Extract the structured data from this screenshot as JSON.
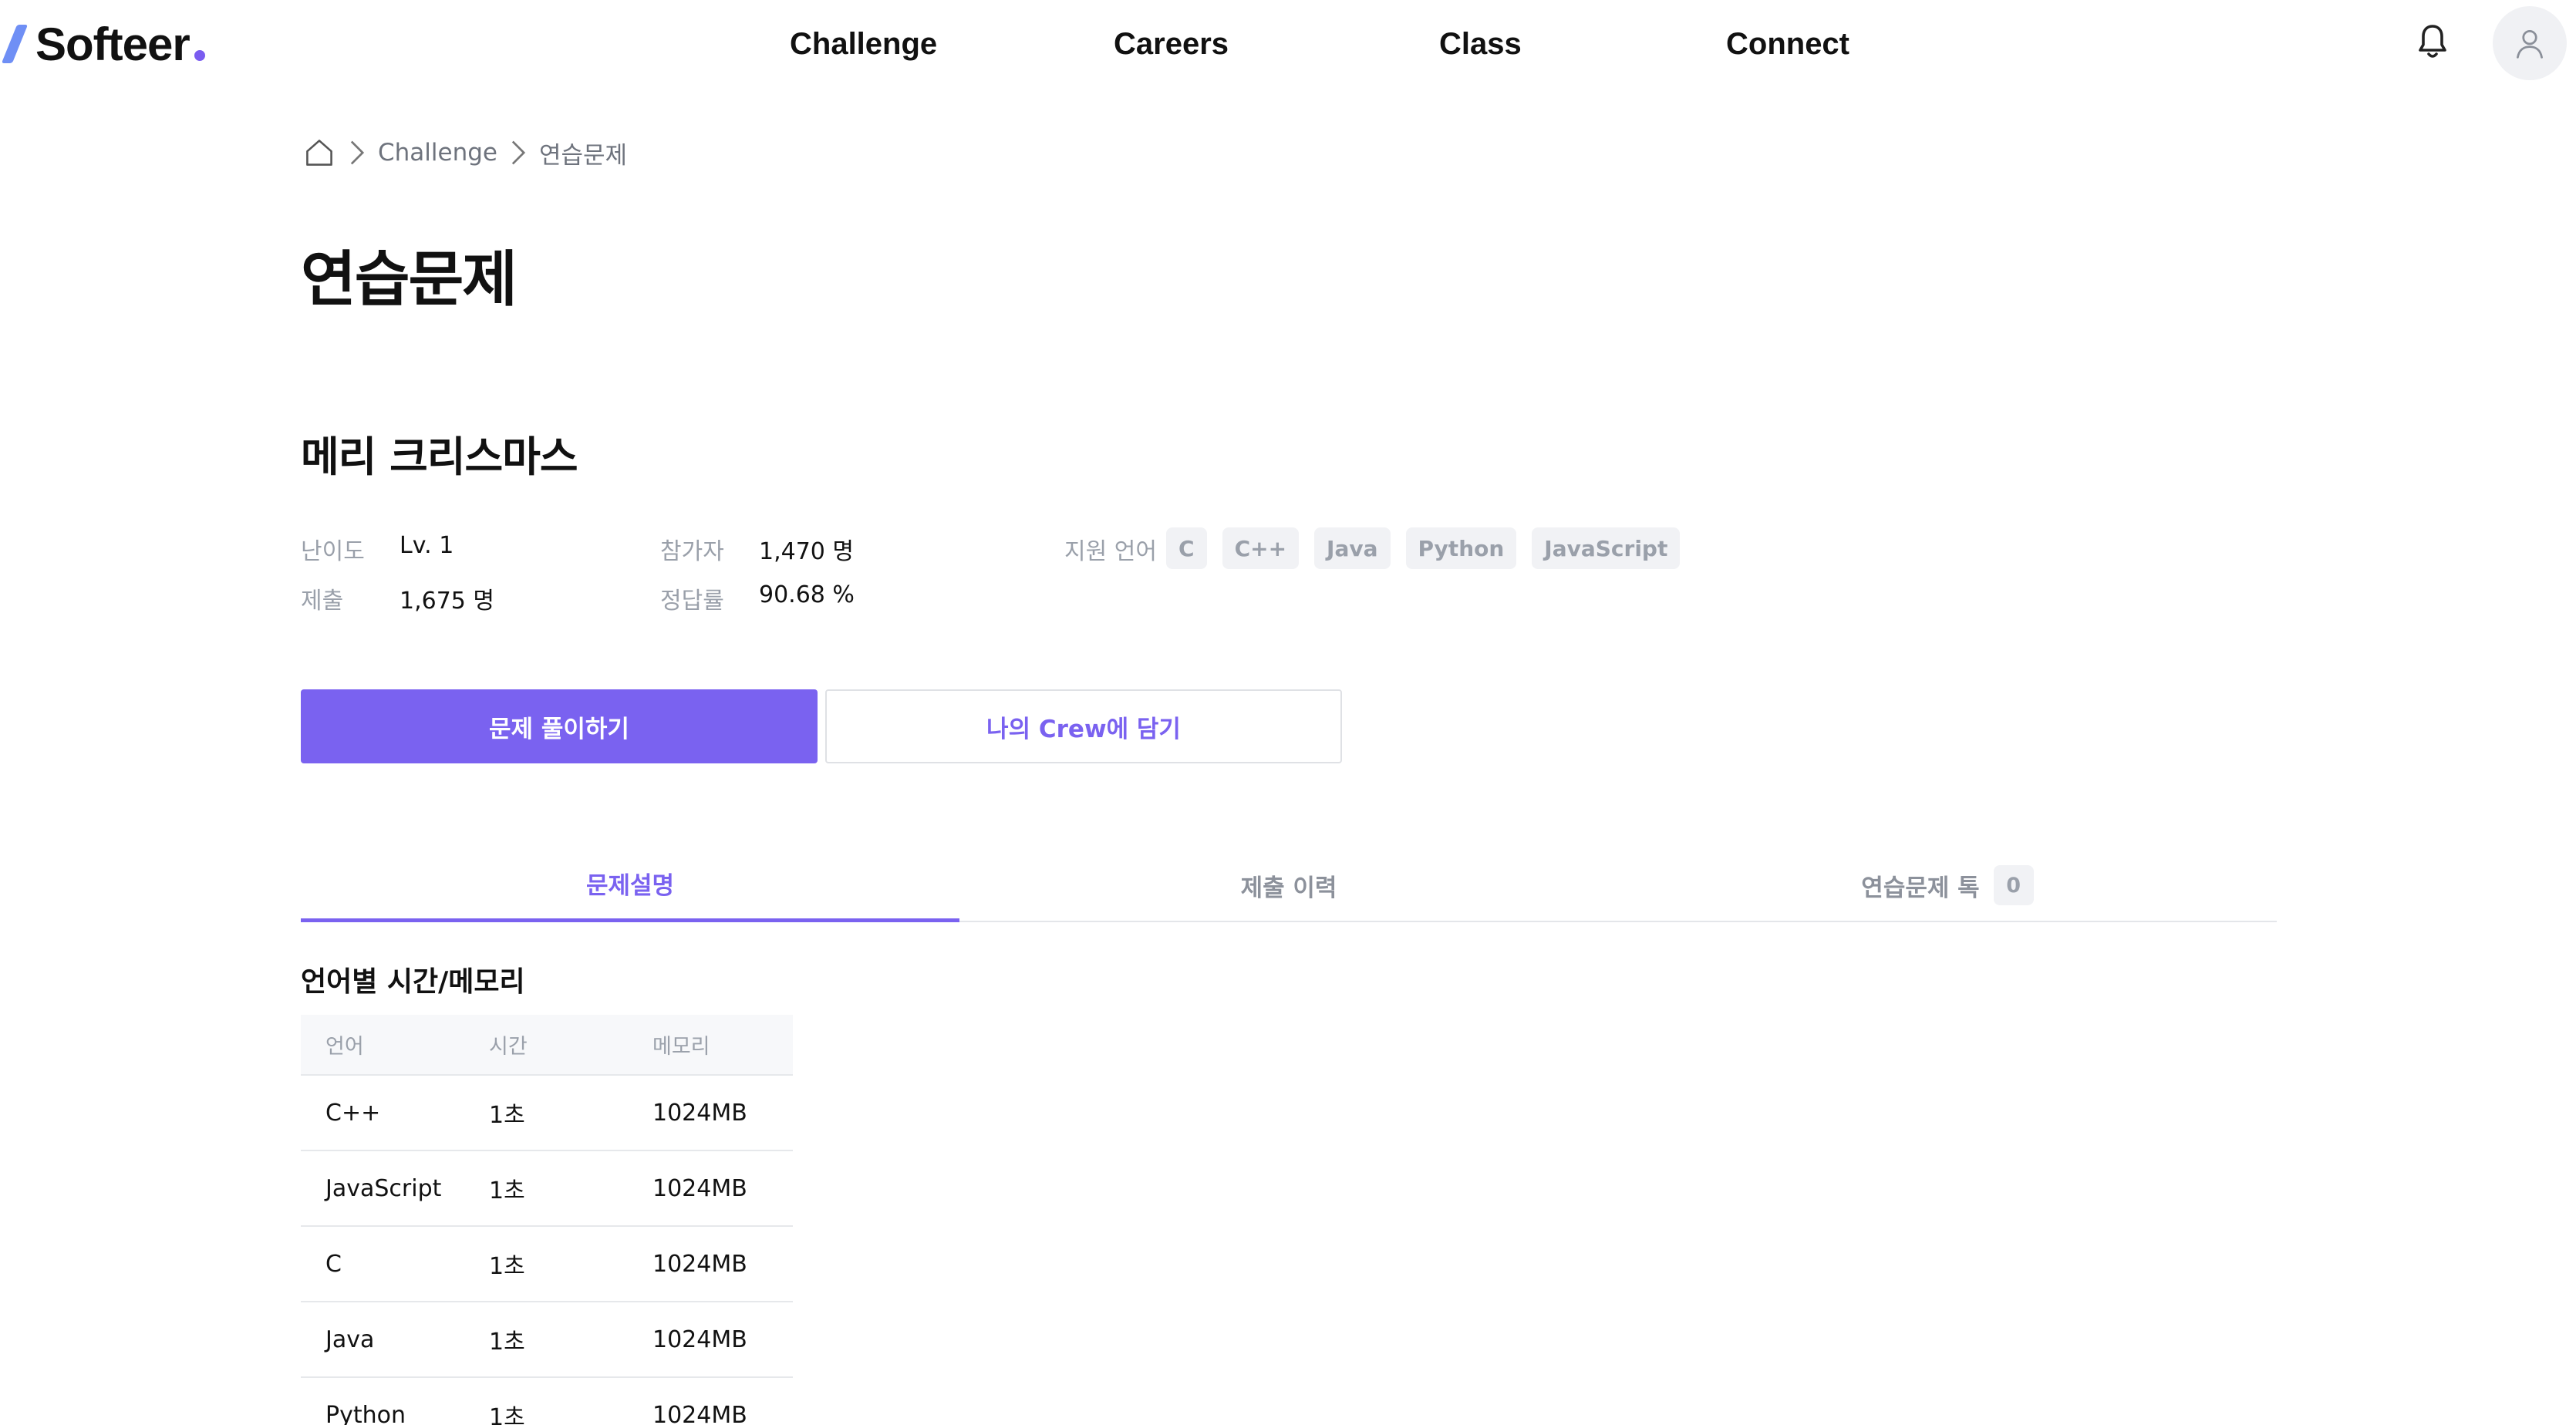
{
  "header": {
    "logo_text": "Softeer",
    "nav": [
      "Challenge",
      "Careers",
      "Class",
      "Connect"
    ],
    "icons": [
      "bell-icon",
      "user-icon"
    ]
  },
  "breadcrumb": {
    "items": [
      "Challenge",
      "연습문제"
    ]
  },
  "page_title": "연습문제",
  "problem": {
    "title": "메리 크리스마스",
    "difficulty_label": "난이도",
    "difficulty_value": "Lv. 1",
    "participants_label": "참가자",
    "participants_value": "1,470 명",
    "submissions_label": "제출",
    "submissions_value": "1,675 명",
    "accuracy_label": "정답률",
    "accuracy_value": "90.68 %",
    "languages_label": "지원 언어",
    "languages": [
      "C",
      "C++",
      "Java",
      "Python",
      "JavaScript"
    ]
  },
  "buttons": {
    "solve": "문제 풀이하기",
    "add_crew": "나의 Crew에 담기"
  },
  "tabs": {
    "description": "문제설명",
    "history": "제출 이력",
    "talk": "연습문제 톡",
    "talk_count": "0"
  },
  "limits": {
    "title": "언어별 시간/메모리",
    "headers": [
      "언어",
      "시간",
      "메모리"
    ],
    "rows": [
      [
        "C++",
        "1초",
        "1024MB"
      ],
      [
        "JavaScript",
        "1초",
        "1024MB"
      ],
      [
        "C",
        "1초",
        "1024MB"
      ],
      [
        "Java",
        "1초",
        "1024MB"
      ],
      [
        "Python",
        "1초",
        "1024MB"
      ]
    ]
  },
  "colors": {
    "accent": "#7a62f0",
    "logo_slash": "#6f8ff5",
    "muted_text": "#9aa0aa"
  }
}
